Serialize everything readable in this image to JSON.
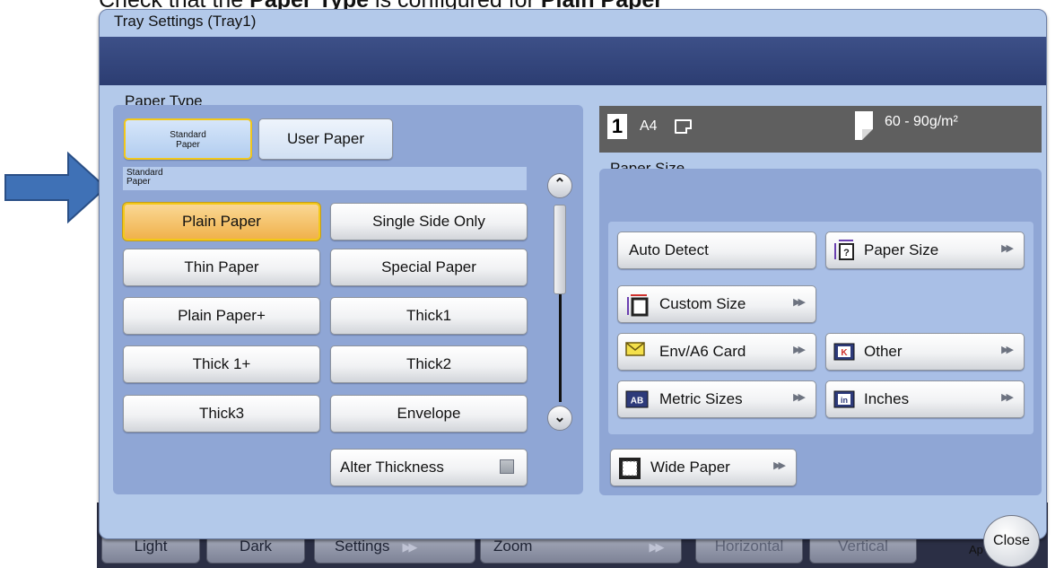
{
  "caption": {
    "prefix": "Check that the ",
    "bold1": "Paper Type",
    "middle": " is configured for ",
    "bold2": "Plain Paper"
  },
  "dialog": {
    "title": "Tray Settings (Tray1)"
  },
  "paper_type": {
    "label": "Paper Type",
    "tabs": [
      {
        "label_line1": "Standard",
        "label_line2": "Paper",
        "selected": true
      },
      {
        "label": "User Paper",
        "selected": false
      }
    ],
    "category_line1": "Standard",
    "category_line2": "Paper",
    "types": [
      "Plain Paper",
      "Single Side Only",
      "Thin Paper",
      "Special Paper",
      "Plain Paper+",
      "Thick1",
      "Thick 1+",
      "Thick2",
      "Thick3",
      "Envelope"
    ],
    "selected": "Plain Paper",
    "alter_thickness": {
      "label": "Alter Thickness",
      "checked": false
    }
  },
  "status": {
    "tray": "1",
    "size": "A4",
    "weight": "60 - 90g/m²"
  },
  "paper_size": {
    "label": "Paper Size",
    "auto_detect": "Auto Detect",
    "paper_size_btn": "Paper Size",
    "custom_size": "Custom Size",
    "env_card": "Env/A6 Card",
    "other": "Other",
    "metric_sizes": "Metric Sizes",
    "inches": "Inches",
    "wide_paper": "Wide Paper"
  },
  "background_buttons": [
    "Light",
    "Dark",
    "Settings",
    "Zoom",
    "Horizontal",
    "Vertical"
  ],
  "close_label": "Close",
  "ap_text": "Ap",
  "colors": {
    "panel": "#8fa6d5",
    "title_band": "#2c3d72",
    "selected_fill": "#f0b24c",
    "selected_border": "#f3c81a",
    "pointer_arrow": "#3d6eb2"
  },
  "icons": {
    "pointer": "arrow-right-icon",
    "scroll_up": "chevron-up-icon",
    "scroll_down": "chevron-down-icon",
    "forward": "double-chevron-right-icon"
  }
}
